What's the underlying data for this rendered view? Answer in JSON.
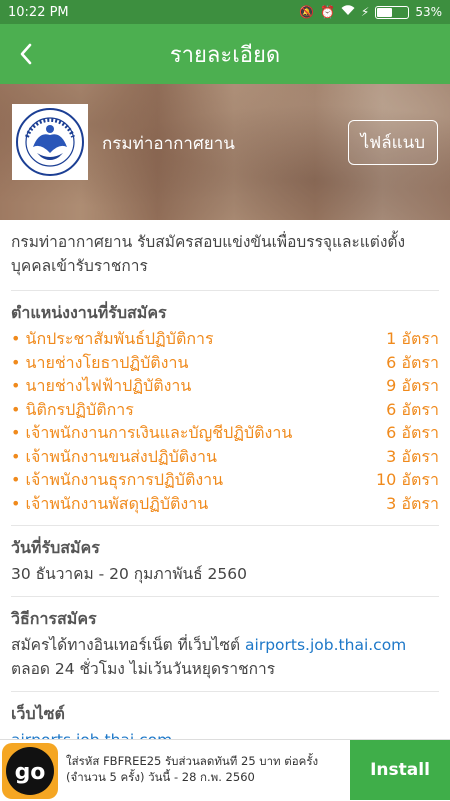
{
  "status": {
    "time": "10:22 PM",
    "battery": "53%",
    "battery_level": 0.53
  },
  "appbar": {
    "title": "รายละเอียด"
  },
  "hero": {
    "org_name": "กรมท่าอากาศยาน",
    "attach_label": "ไฟล์แนบ"
  },
  "description": "กรมท่าอากาศยาน รับสมัครสอบแข่งขันเพื่อบรรจุและแต่งตั้งบุคคลเข้ารับราชการ",
  "positions": {
    "title": "ตำแหน่งงานที่รับสมัคร",
    "items": [
      {
        "name": "• นักประชาสัมพันธ์ปฏิบัติการ",
        "count": "1 อัตรา"
      },
      {
        "name": "• นายช่างโยธาปฏิบัติงาน",
        "count": "6 อัตรา"
      },
      {
        "name": "• นายช่างไฟฟ้าปฏิบัติงาน",
        "count": "9 อัตรา"
      },
      {
        "name": "• นิติกรปฏิบัติการ",
        "count": "6 อัตรา"
      },
      {
        "name": "• เจ้าพนักงานการเงินและบัญชีปฏิบัติงาน",
        "count": "6 อัตรา"
      },
      {
        "name": "• เจ้าพนักงานขนส่งปฏิบัติงาน",
        "count": "3 อัตรา"
      },
      {
        "name": "• เจ้าพนักงานธุรการปฏิบัติงาน",
        "count": "10 อัตรา"
      },
      {
        "name": "• เจ้าพนักงานพัสดุปฏิบัติงาน",
        "count": "3 อัตรา"
      }
    ]
  },
  "dates": {
    "title": "วันที่รับสมัคร",
    "value": "30 ธันวาคม - 20 กุมภาพันธ์ 2560"
  },
  "method": {
    "title": "วิธีการสมัคร",
    "text_prefix": "สมัครได้ทางอินเทอร์เน็ต ที่เว็บไซต์ ",
    "link": "airports.job.thai.com",
    "text_suffix": "ตลอด 24 ชั่วโมง ไม่เว้นวันหยุดราชการ"
  },
  "website": {
    "title": "เว็บไซต์",
    "link": "airports.job.thai.com"
  },
  "ad": {
    "logo_text": "go",
    "line1": "ใส่รหัส FBFREE25 รับส่วนลดทันที 25 บาท ต่อครั้ง",
    "line2": "(จำนวน 5 ครั้ง) วันนี้ - 28 ก.พ. 2560",
    "install_label": "Install"
  },
  "colors": {
    "statusbar": "#3d8f3f",
    "appbar": "#4caf50",
    "accent": "#f08a1c",
    "link": "#1e78c8",
    "install": "#3fae49"
  }
}
